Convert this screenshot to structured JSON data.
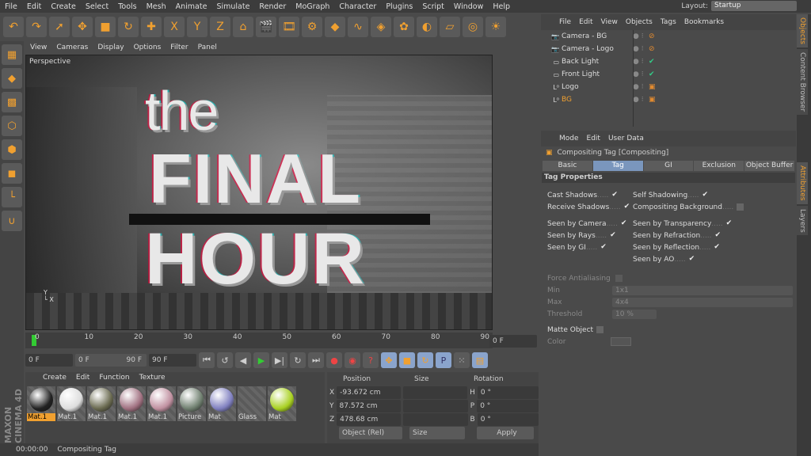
{
  "menu": [
    "File",
    "Edit",
    "Create",
    "Select",
    "Tools",
    "Mesh",
    "Animate",
    "Simulate",
    "Render",
    "MoGraph",
    "Character",
    "Plugins",
    "Script",
    "Window",
    "Help"
  ],
  "layout": {
    "label": "Layout:",
    "value": "Startup"
  },
  "toolbar_icons": [
    "undo-icon",
    "redo-icon",
    "live-select-icon",
    "move-icon",
    "scale-icon",
    "rotate-icon",
    "add-icon",
    "x-axis-icon",
    "y-axis-icon",
    "z-axis-icon",
    "world-coords-icon",
    "render-view-icon",
    "render-picture-viewer-icon",
    "render-settings-icon",
    "cube-icon",
    "spline-icon",
    "nurbs-icon",
    "array-icon",
    "deformer-icon",
    "floor-icon",
    "camera-icon",
    "light-icon"
  ],
  "viewport": {
    "menu": [
      "View",
      "Cameras",
      "Display",
      "Options",
      "Filter",
      "Panel"
    ],
    "label": "Perspective",
    "scene_text": [
      "the",
      "FINAL",
      "HOUR"
    ]
  },
  "timeline": {
    "ticks": [
      "0",
      "10",
      "20",
      "30",
      "40",
      "50",
      "60",
      "70",
      "80",
      "90"
    ],
    "current": "0 F",
    "start": "0 F",
    "range_start": "0 F",
    "range_end": "90 F",
    "end": "90 F"
  },
  "material_manager": {
    "menu": [
      "Create",
      "Edit",
      "Function",
      "Texture"
    ],
    "materials": [
      {
        "name": "Mat.1",
        "color": "#222",
        "selected": true
      },
      {
        "name": "Mat.1",
        "color": "#ddd"
      },
      {
        "name": "Mat.1",
        "color": "#6a6a50"
      },
      {
        "name": "Mat.1",
        "color": "#a07080"
      },
      {
        "name": "Mat.1",
        "color": "#c090a0"
      },
      {
        "name": "Picture",
        "color": "#708070"
      },
      {
        "name": "Mat",
        "color": "#8080c0"
      },
      {
        "name": "Glass",
        "color": ""
      },
      {
        "name": "Mat",
        "color": "#a8d020"
      }
    ]
  },
  "coordinates": {
    "headers": [
      "Position",
      "Size",
      "Rotation"
    ],
    "rows": [
      {
        "axis": "X",
        "pos": "-93.672 cm",
        "rot_axis": "H",
        "rot": "0 °"
      },
      {
        "axis": "Y",
        "pos": "87.572 cm",
        "rot_axis": "P",
        "rot": "0 °"
      },
      {
        "axis": "Z",
        "pos": "478.68 cm",
        "rot_axis": "B",
        "rot": "0 °"
      }
    ],
    "mode": "Object (Rel)",
    "size_mode": "Size",
    "apply": "Apply"
  },
  "status": {
    "time": "00:00:00",
    "text": "Compositing Tag"
  },
  "branding": "MAXON CINEMA 4D",
  "object_manager": {
    "menu": [
      "File",
      "Edit",
      "View",
      "Objects",
      "Tags",
      "Bookmarks"
    ],
    "objects": [
      {
        "name": "Camera - BG",
        "type": "camera"
      },
      {
        "name": "Camera - Logo",
        "type": "camera"
      },
      {
        "name": "Back Light",
        "type": "light"
      },
      {
        "name": "Front Light",
        "type": "light"
      },
      {
        "name": "Logo",
        "type": "null"
      },
      {
        "name": "BG",
        "type": "null",
        "selected": true
      }
    ]
  },
  "attributes": {
    "menu": [
      "Mode",
      "Edit",
      "User Data"
    ],
    "title": "Compositing Tag [Compositing]",
    "tabs": [
      "Basic",
      "Tag",
      "GI",
      "Exclusion",
      "Object Buffer"
    ],
    "active_tab": "Tag",
    "section": "Tag Properties",
    "left": [
      {
        "label": "Cast Shadows",
        "checked": true
      },
      {
        "label": "Receive Shadows",
        "checked": true
      },
      {
        "label": "Seen by Camera",
        "checked": true
      },
      {
        "label": "Seen by Rays",
        "checked": true
      },
      {
        "label": "Seen by GI",
        "checked": true
      }
    ],
    "right": [
      {
        "label": "Self Shadowing",
        "checked": true
      },
      {
        "label": "Compositing Background",
        "checked": false
      },
      {
        "label": "Seen by Transparency",
        "checked": true
      },
      {
        "label": "Seen by Refraction",
        "checked": true
      },
      {
        "label": "Seen by Reflection",
        "checked": true
      },
      {
        "label": "Seen by AO",
        "checked": true
      }
    ],
    "force_aa": "Force Antialiasing",
    "min_label": "Min",
    "min": "1x1",
    "max_label": "Max",
    "max": "4x4",
    "threshold_label": "Threshold",
    "threshold": "10 %",
    "matte": "Matte Object",
    "color": "Color"
  },
  "side_tabs": [
    "Objects",
    "Content Browser",
    "Attributes",
    "Layers"
  ]
}
